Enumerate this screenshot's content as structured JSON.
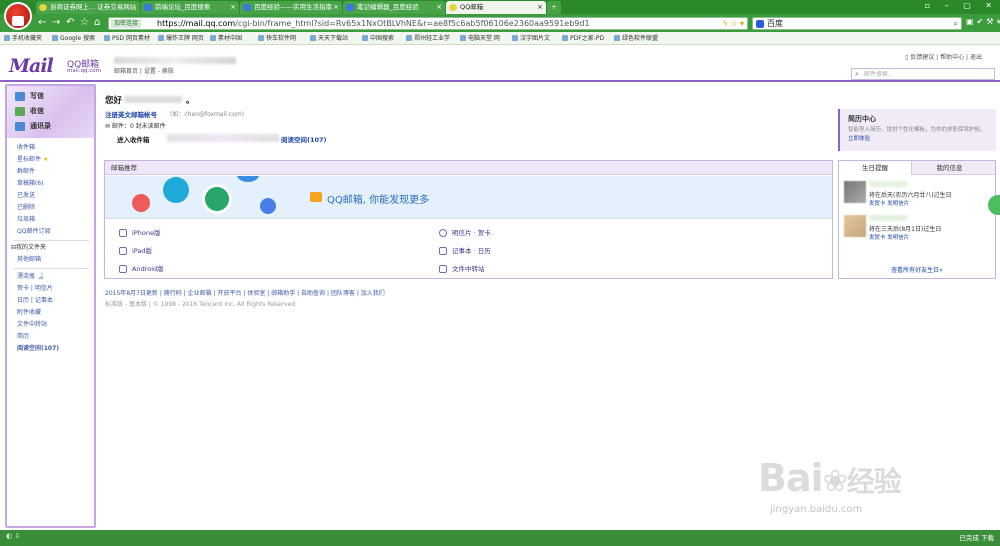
{
  "browser": {
    "tabs": [
      {
        "label": "浙商证券网上... 证券交易网站",
        "active": false
      },
      {
        "label": "前端论坛_百度搜索",
        "active": false
      },
      {
        "label": "百度经验——实用生活指南",
        "active": false
      },
      {
        "label": "笔记编辑器_百度经验",
        "active": false
      },
      {
        "label": "QQ邮箱",
        "active": true
      }
    ],
    "secure_badge": "加密连接",
    "url_host": "https://mail.qq.com",
    "url_rest": "/cgi-bin/frame_html?sid=Rv65x1NxOtBLVhNE&r=ae8f5c6ab5f06106e2360aa9591eb9d1",
    "search_engine": "百度",
    "bookmarks": [
      "手机收藏夹",
      "Google 搜索",
      "PSD 网页素材",
      "爆炸王牌 网页",
      "素材中国",
      "快车软件网",
      "天天下载站",
      "中国搜索",
      "郑州轻工业学",
      "电脑天堂 网",
      "汉字图片文",
      "PDF之家-PD",
      "绿色软件联盟"
    ]
  },
  "header": {
    "logo_text": "Mail",
    "logo_cn": "QQ邮箱",
    "logo_sub": "mail.qq.com",
    "links": [
      "邮箱首页",
      "设置",
      "换肤"
    ],
    "top_right": [
      "反馈建议",
      "帮助中心",
      "退出"
    ],
    "search_placeholder": "邮件搜索..."
  },
  "sidebar": {
    "buttons": [
      {
        "label": "写信",
        "icon": "compose-icon"
      },
      {
        "label": "收信",
        "icon": "inbox-icon"
      },
      {
        "label": "通讯录",
        "icon": "contacts-icon"
      }
    ],
    "folders": [
      "收件箱",
      "星标邮件",
      "群邮件",
      "草稿箱(6)",
      "已发送",
      "已删除",
      "垃圾箱",
      "QQ邮件订阅"
    ],
    "my_folders": "我的文件夹",
    "other_mail": "其他邮箱",
    "apps": {
      "drift_bottle": "漂流瓶",
      "row1": [
        "贺卡",
        "明信片"
      ],
      "row2": [
        "日历",
        "记事本"
      ],
      "items": [
        "附件收藏",
        "文件中转站",
        "简历",
        "阅读空间(107)"
      ]
    }
  },
  "main": {
    "greeting": "您好",
    "greeting_suffix": "。",
    "register_link": "注册英文邮箱帐号",
    "register_hint": "(如：chen@foxmail.com)",
    "mail_stat": "邮件：0 封未读邮件",
    "enter_inbox": "进入收件箱",
    "read_space": "阅读空间(107)"
  },
  "recommend": {
    "title": "邮箱推荐",
    "banner_text": "QQ邮箱, 你能发现更多",
    "left_links": [
      "iPhone版",
      "iPad版",
      "Android版"
    ],
    "right_links": [
      "明信片 · 贺卡",
      "记事本 · 日历",
      "文件中转站"
    ]
  },
  "resume": {
    "title": "简历中心",
    "desc": "智能导入简历，提供个性化模板，为你的求职保驾护航。",
    "link": "立即体验"
  },
  "birthday": {
    "tabs": [
      "生日提醒",
      "我的信息"
    ],
    "rows": [
      {
        "text": "将在后天(农历六月廿八)过生日",
        "links": [
          "发贺卡",
          "发明信片"
        ]
      },
      {
        "text": "将在三天后(8月1日)过生日",
        "links": [
          "发贺卡",
          "发明信片"
        ]
      }
    ],
    "all_link": "查看所有好友生日»"
  },
  "footer": {
    "line1": [
      "2015年8月7日更新",
      "随行码",
      "企业邮箱",
      "开放平台",
      "体验室",
      "邮箱助手",
      "自助查询",
      "团队博客",
      "加入我们"
    ],
    "line2": "标准版 - 基本版 | © 1998 - 2016 Tencent Inc. All Rights Reserved"
  },
  "statusbar": {
    "right": "已完成  下载"
  },
  "watermark": {
    "brand": "Bai",
    "brand2": "经验",
    "sub": "jingyan.baidu.com"
  }
}
